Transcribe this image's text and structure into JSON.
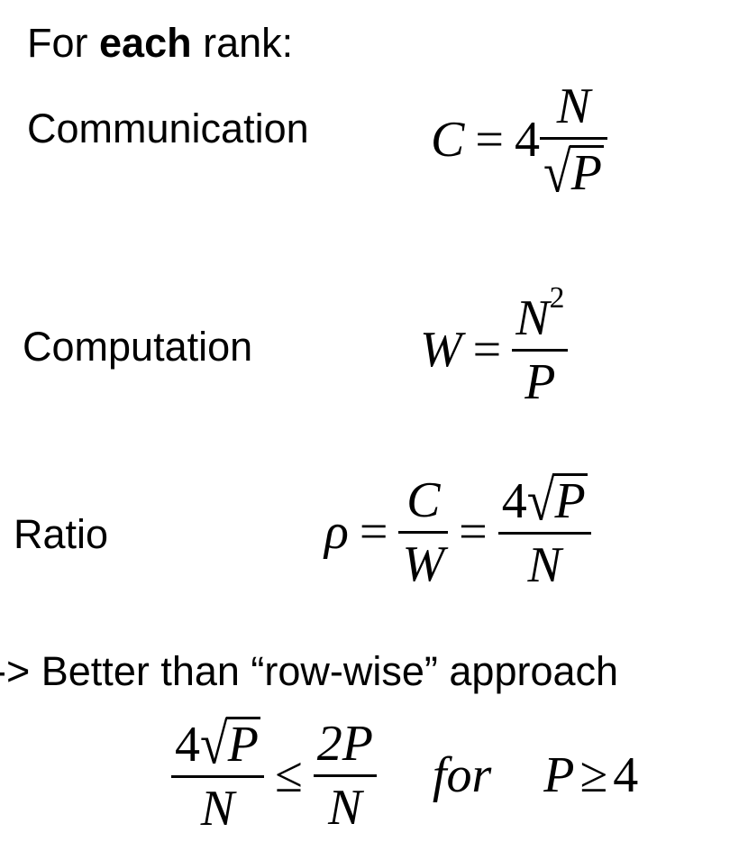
{
  "heading": {
    "prefix": "For ",
    "emphasis": "each",
    "suffix": " rank:"
  },
  "rows": {
    "communication": {
      "label": "Communication",
      "lhs": "C",
      "eq": "=",
      "coef": "4",
      "num": "N",
      "rad_sign": "√",
      "radicand": "P"
    },
    "computation": {
      "label": "Computation",
      "lhs": "W",
      "eq": "=",
      "num": "N",
      "num_exp": "2",
      "den": "P"
    },
    "ratio": {
      "label": "Ratio",
      "lhs": "ρ",
      "eq1": "=",
      "num1": "C",
      "den1": "W",
      "eq2": "=",
      "coef": "4",
      "rad_sign": "√",
      "radicand": "P",
      "den2": "N"
    }
  },
  "conclusion": {
    "text": "-> Better than “row-wise” approach"
  },
  "inequality": {
    "left_coef": "4",
    "rad_sign": "√",
    "radicand": "P",
    "left_den": "N",
    "op": "≤",
    "right_num": "2P",
    "right_den": "N",
    "for_word": "for",
    "cond_var": "P",
    "cond_op": "≥",
    "cond_val": "4"
  }
}
